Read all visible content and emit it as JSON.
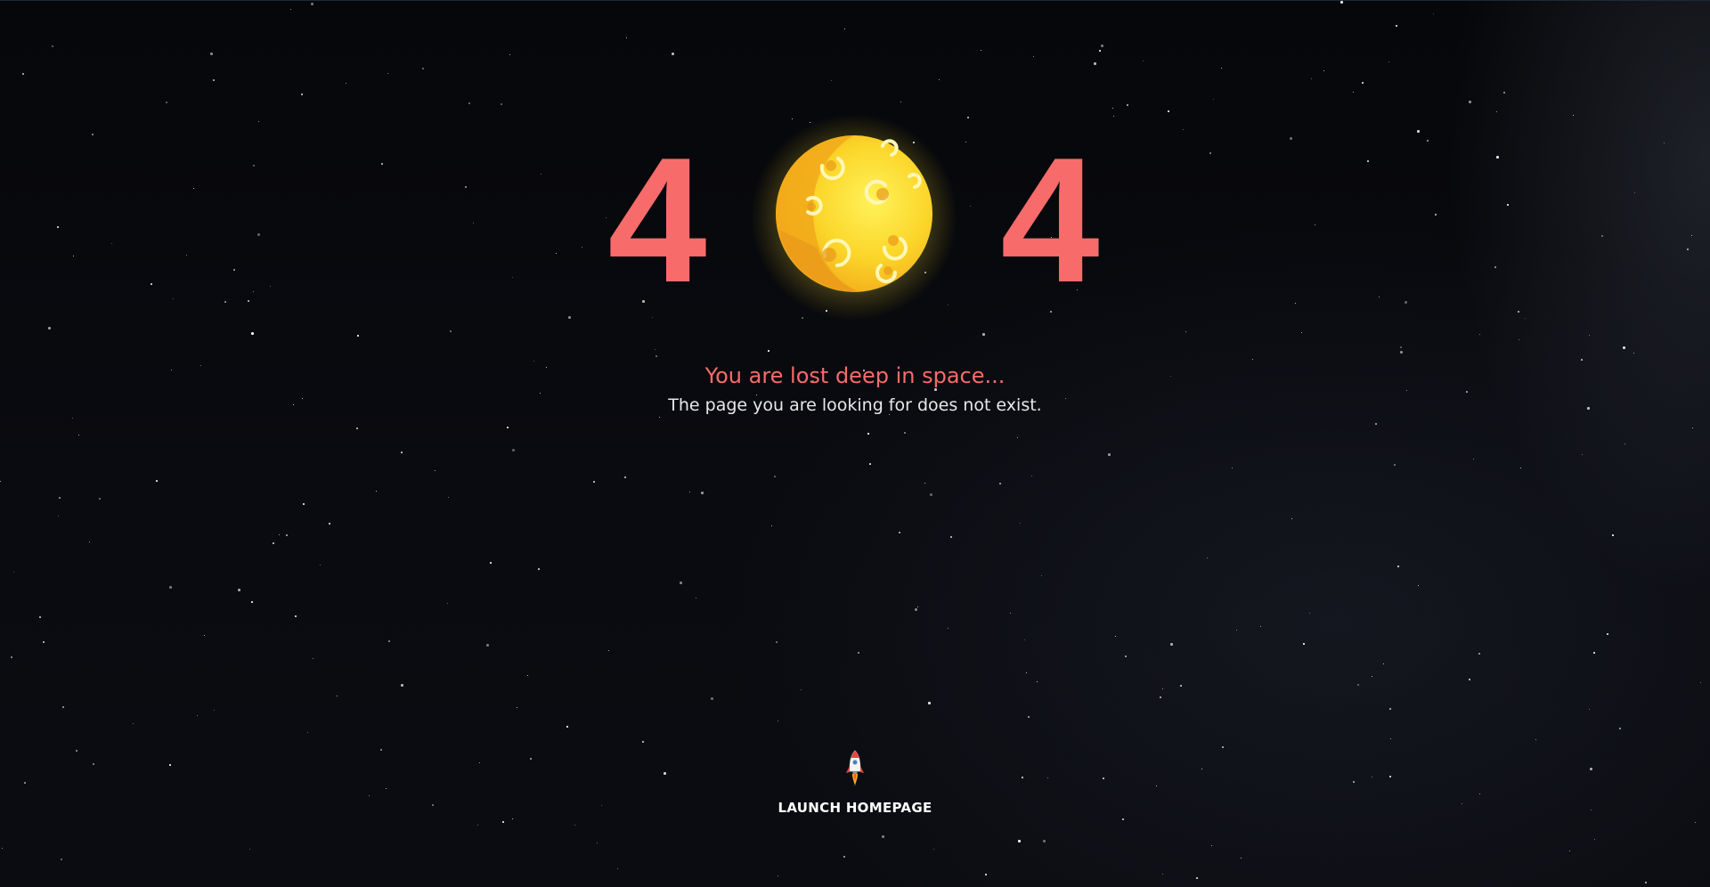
{
  "error": {
    "digit_left": "4",
    "digit_right": "4",
    "middle_graphic": "moon-icon"
  },
  "message": {
    "title": "You are lost deep in space...",
    "subtitle": "The page you are looking for does not exist."
  },
  "action": {
    "icon": "rocket-icon",
    "label": "LAUNCH HOMEPAGE"
  },
  "colors": {
    "accent": "#f76b6b",
    "moon": "#f9d524",
    "background": "#07080b",
    "text": "#e8e8ea"
  }
}
